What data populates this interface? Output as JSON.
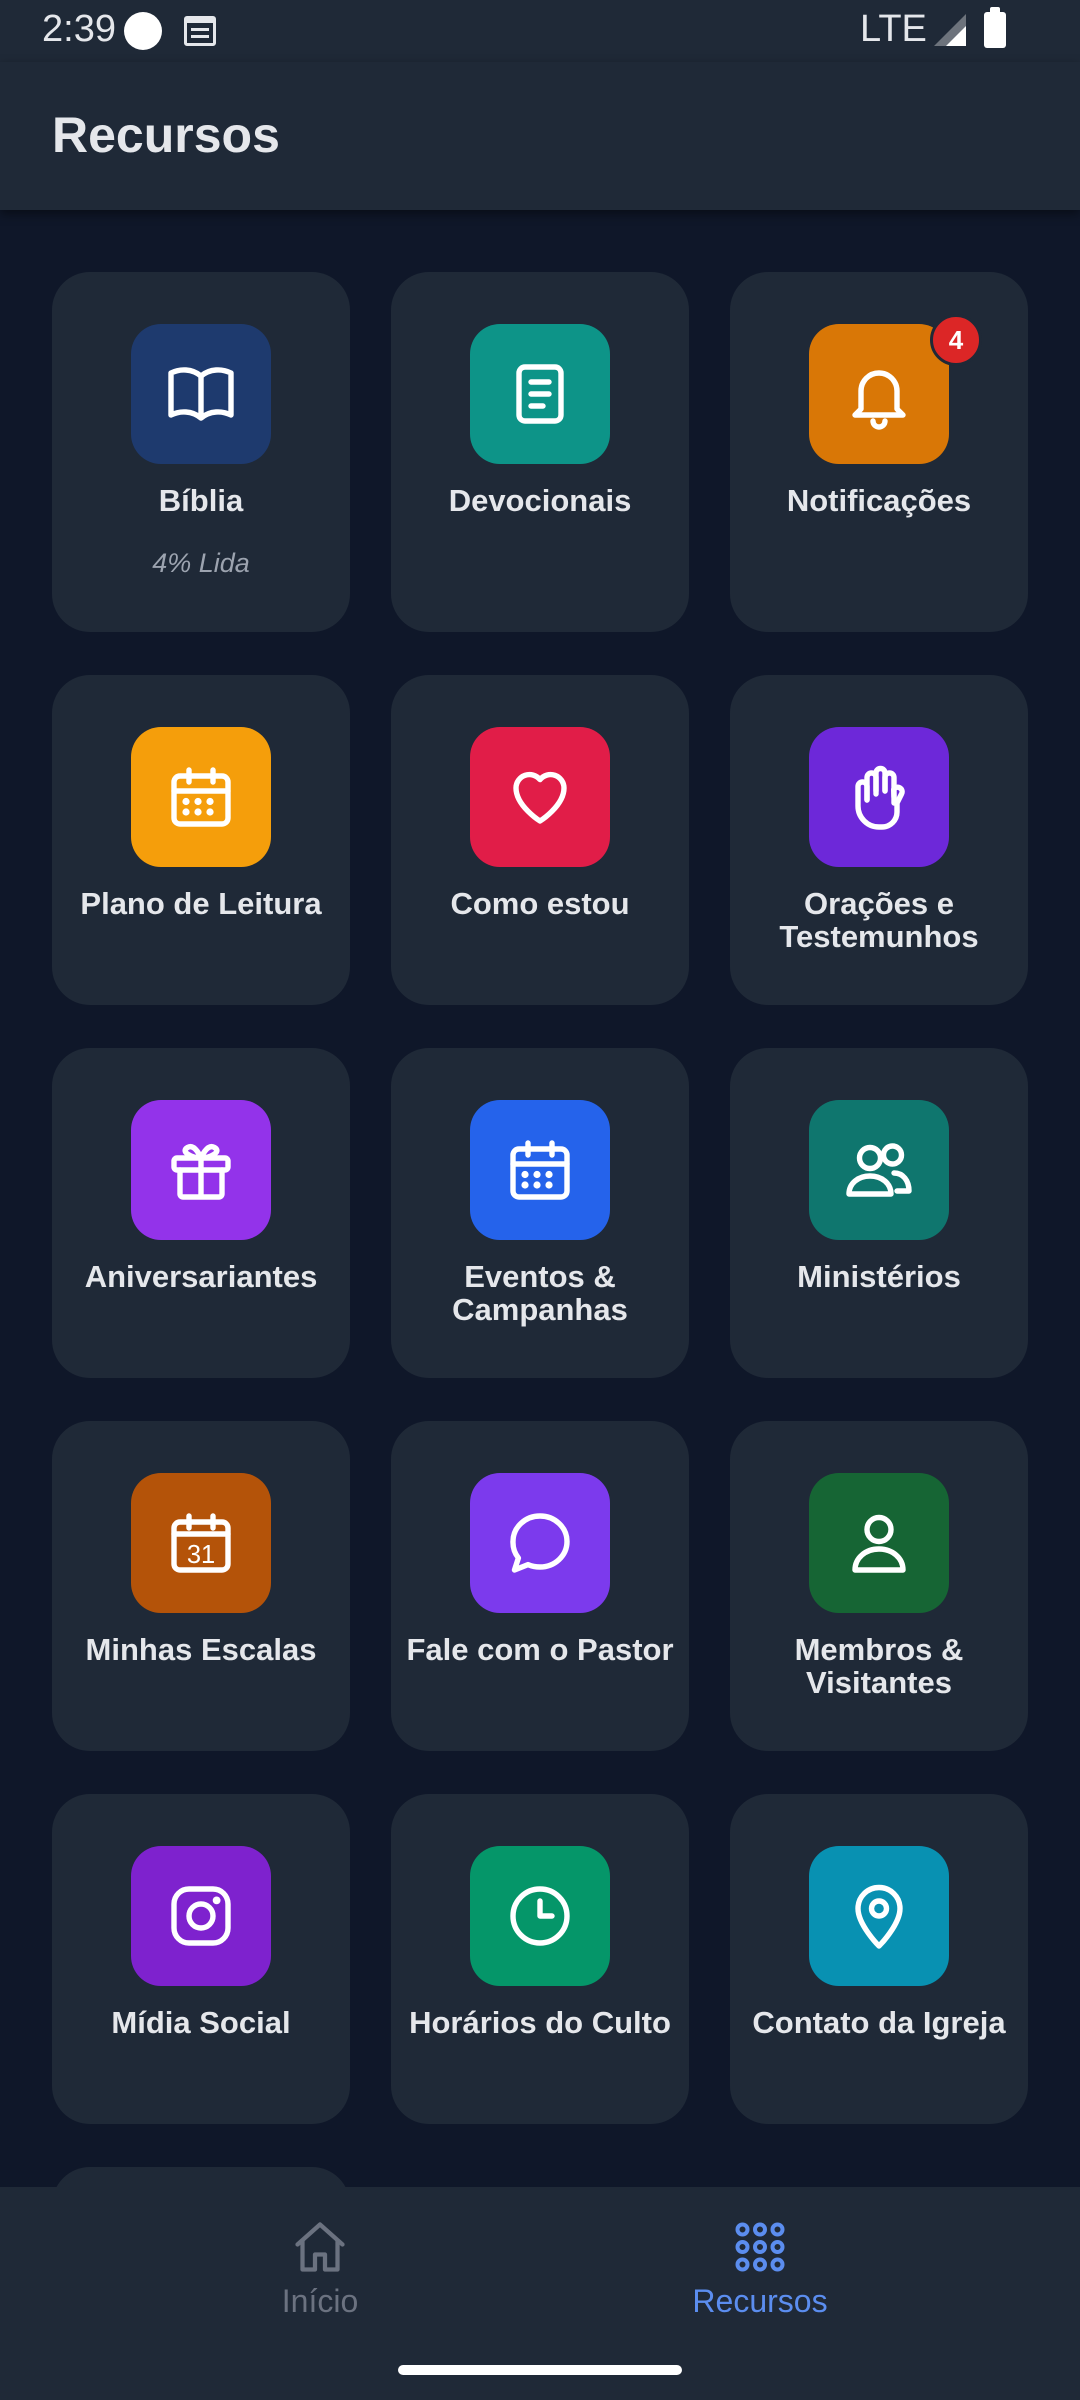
{
  "status_bar": {
    "time": "2:39",
    "network": "LTE"
  },
  "header": {
    "title": "Recursos"
  },
  "colors": {
    "background": "#0f1729",
    "card": "#1f2937",
    "active_nav": "#5b8def",
    "badge": "#dc2626"
  },
  "resources": [
    {
      "label": "Bíblia",
      "subtitle": "4% Lida",
      "icon": "book-icon",
      "color": "#1e3a6e"
    },
    {
      "label": "Devocionais",
      "icon": "document-icon",
      "color": "#0d9488"
    },
    {
      "label": "Notificações",
      "icon": "bell-icon",
      "color": "#d97706",
      "badge": "4"
    },
    {
      "label": "Plano de Leitura",
      "icon": "calendar-icon",
      "color": "#f59e0b"
    },
    {
      "label": "Como estou",
      "icon": "heart-icon",
      "color": "#e11d48"
    },
    {
      "label": "Orações e Testemunhos",
      "icon": "hand-icon",
      "color": "#6d28d9"
    },
    {
      "label": "Aniversariantes",
      "icon": "gift-icon",
      "color": "#9333ea"
    },
    {
      "label": "Eventos & Campanhas",
      "icon": "calendar-icon",
      "color": "#2563eb"
    },
    {
      "label": "Ministérios",
      "icon": "users-icon",
      "color": "#0f766e"
    },
    {
      "label": "Minhas Escalas",
      "icon": "calendar-31-icon",
      "color": "#b45309",
      "icon_text": "31"
    },
    {
      "label": "Fale com o Pastor",
      "icon": "chat-bubble-icon",
      "color": "#7c3aed"
    },
    {
      "label": "Membros & Visitantes",
      "icon": "user-icon",
      "color": "#166534"
    },
    {
      "label": "Mídia Social",
      "icon": "instagram-icon",
      "color": "#7e22ce"
    },
    {
      "label": "Horários do Culto",
      "icon": "clock-icon",
      "color": "#059669"
    },
    {
      "label": "Contato da Igreja",
      "icon": "map-pin-icon",
      "color": "#0891b2"
    }
  ],
  "bottom_nav": {
    "home_label": "Início",
    "resources_label": "Recursos",
    "active": "resources"
  }
}
